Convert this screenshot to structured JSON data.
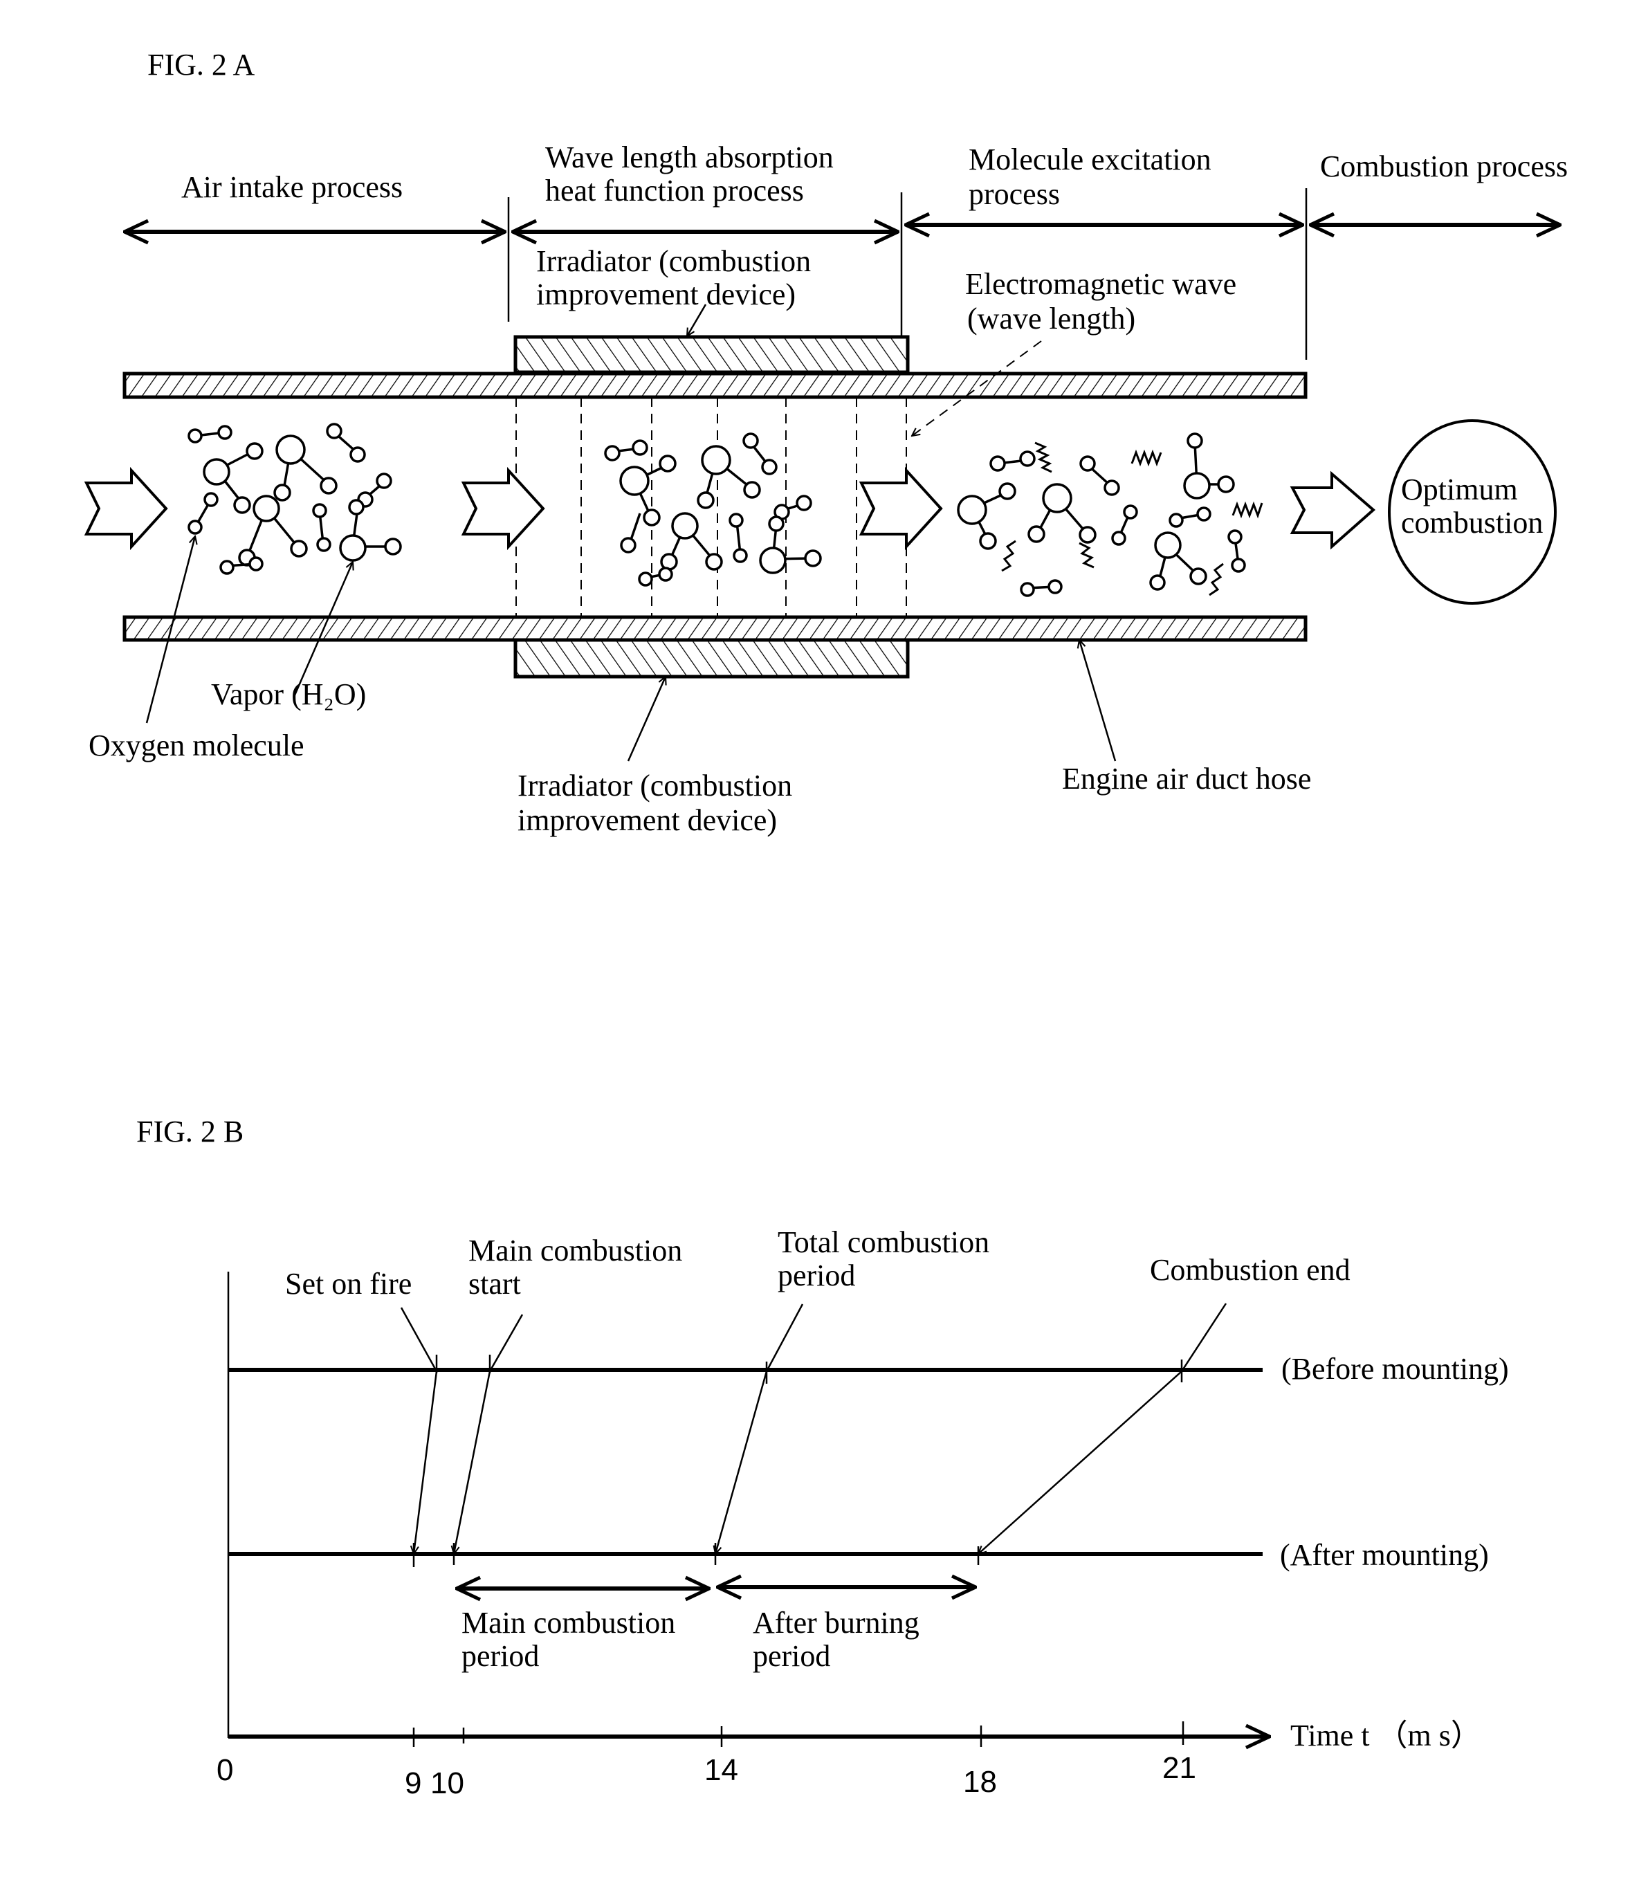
{
  "fig_a": {
    "title": "FIG. 2 A",
    "processes": [
      {
        "label_lines": [
          "Air intake process"
        ]
      },
      {
        "label_lines": [
          "Wave length absorption",
          "heat function process"
        ]
      },
      {
        "label_lines": [
          "Molecule excitation",
          "process"
        ]
      },
      {
        "label_lines": [
          "Combustion process"
        ]
      }
    ],
    "irradiator_top_label": [
      "Irradiator (combustion",
      "improvement device)"
    ],
    "irradiator_bottom_label": [
      "Irradiator (combustion",
      "improvement device)"
    ],
    "em_wave_label": [
      "Electromagnetic wave",
      "(wave length)"
    ],
    "vapor_label": "Vapor (H₂O)",
    "oxygen_label": "Oxygen molecule",
    "duct_label": "Engine air duct hose",
    "result_label": [
      "Optimum",
      "combustion"
    ]
  },
  "fig_b": {
    "title": "FIG. 2 B",
    "annotations": {
      "set_on_fire": [
        "Set on fire"
      ],
      "main_start": [
        "Main combustion",
        "start"
      ],
      "total_period": [
        "Total combustion",
        "period"
      ],
      "combustion_end": [
        "Combustion end"
      ]
    },
    "rows": {
      "before": "(Before mounting)",
      "after": "(After mounting)"
    },
    "periods": {
      "main": [
        "Main combustion",
        "period"
      ],
      "after": [
        "After burning",
        "period"
      ]
    },
    "axis": {
      "label": "Time  t （m s）",
      "origin": "0",
      "ticks": [
        "9",
        "10",
        "14",
        "18",
        "21"
      ]
    }
  },
  "chart_data": {
    "type": "timeline",
    "title": "FIG. 2 B",
    "xlabel": "Time t (ms)",
    "tick_labels": [
      "0",
      "9",
      "10",
      "14",
      "18",
      "21"
    ],
    "series": [
      {
        "name": "(Before mounting)",
        "events": {
          "Set on fire": 9,
          "Main combustion start": 10,
          "Total combustion period": 14,
          "Combustion end": 21
        }
      },
      {
        "name": "(After mounting)",
        "events": {
          "Set on fire": 9,
          "Main combustion start": 10,
          "Total combustion period": 14,
          "Combustion end": 18
        }
      }
    ],
    "periods": [
      {
        "name": "Main combustion period",
        "start": 10,
        "end": 14
      },
      {
        "name": "After burning period",
        "start": 14,
        "end": 18
      }
    ]
  }
}
